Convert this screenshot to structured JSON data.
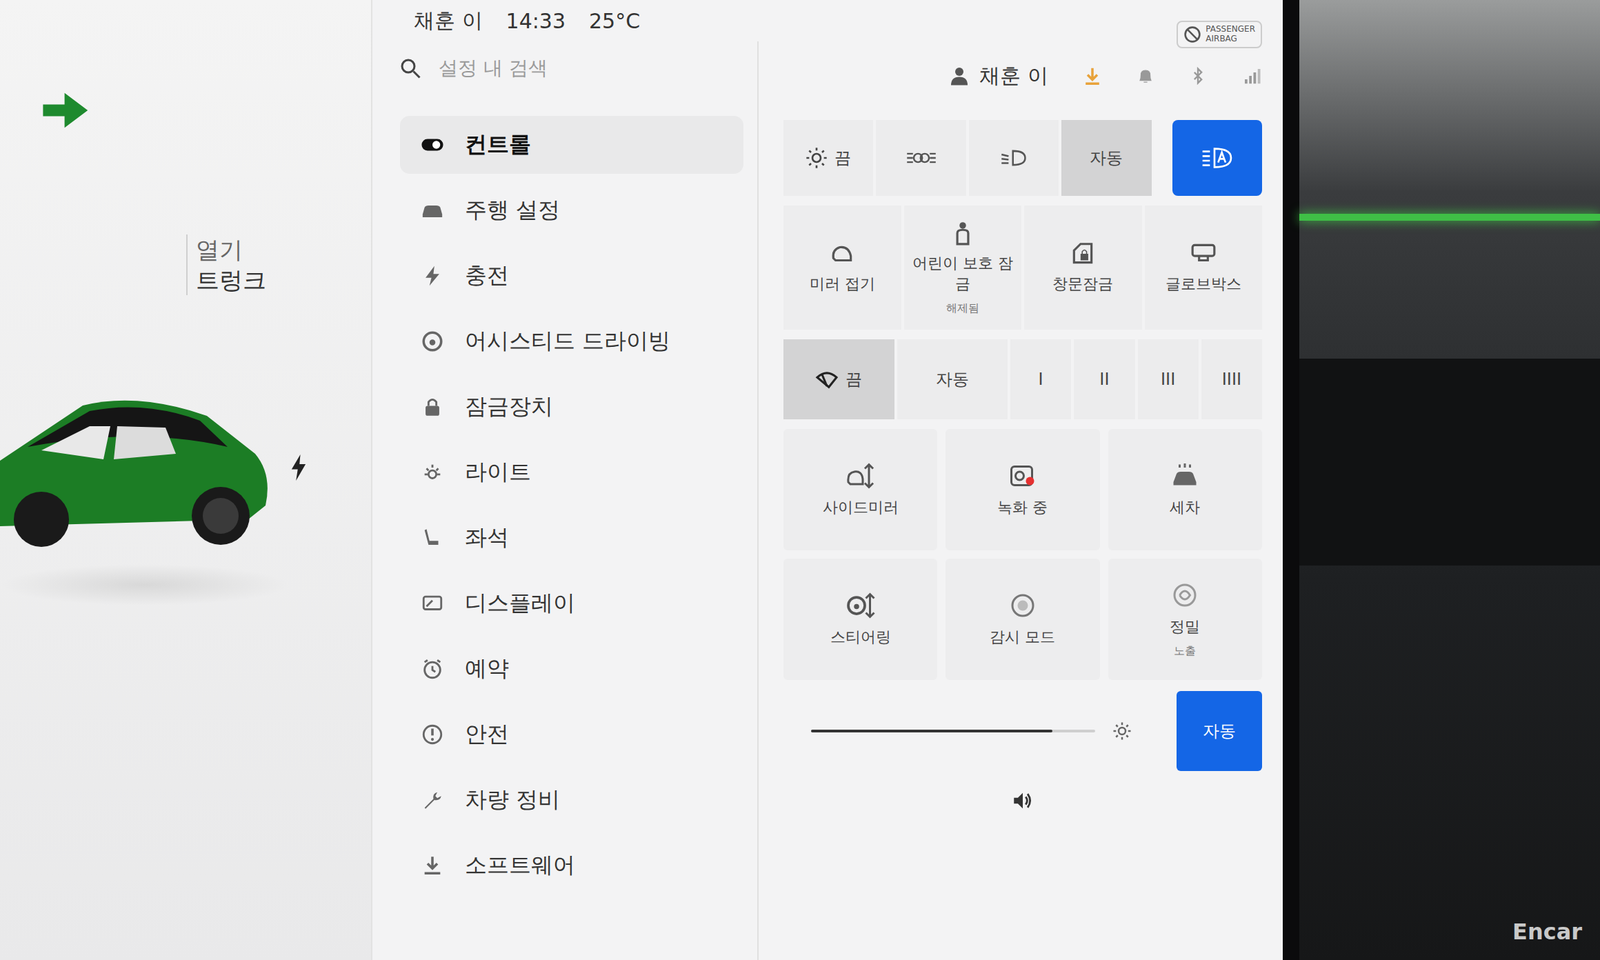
{
  "status_bar": {
    "profile": "채훈 이",
    "time": "14:33",
    "temperature": "25°C"
  },
  "airbag_badge": {
    "line1": "PASSENGER",
    "line2": "AIRBAG"
  },
  "car_panel": {
    "open_label": "열기",
    "trunk_label": "트렁크",
    "charging": true
  },
  "search": {
    "placeholder": "설정 내 검색"
  },
  "menu": [
    {
      "label": "컨트롤",
      "kind": "controls",
      "selected": true
    },
    {
      "label": "주행 설정",
      "kind": "car",
      "selected": false
    },
    {
      "label": "충전",
      "kind": "charge",
      "selected": false
    },
    {
      "label": "어시스티드 드라이빙",
      "kind": "wheel",
      "selected": false
    },
    {
      "label": "잠금장치",
      "kind": "lock",
      "selected": false
    },
    {
      "label": "라이트",
      "kind": "light",
      "selected": false
    },
    {
      "label": "좌석",
      "kind": "seat",
      "selected": false
    },
    {
      "label": "디스플레이",
      "kind": "display",
      "selected": false
    },
    {
      "label": "예약",
      "kind": "clock",
      "selected": false
    },
    {
      "label": "안전",
      "kind": "alert",
      "selected": false
    },
    {
      "label": "차량 정비",
      "kind": "wrench",
      "selected": false
    },
    {
      "label": "소프트웨어",
      "kind": "download",
      "selected": false
    }
  ],
  "profile": {
    "name": "채훈 이"
  },
  "lights": [
    {
      "kind": "off",
      "label": "끔",
      "selected": false
    },
    {
      "kind": "parking",
      "label": "",
      "selected": false
    },
    {
      "kind": "lowbeam",
      "label": "",
      "selected": false
    },
    {
      "kind": "auto",
      "label": "자동",
      "selected": true
    },
    {
      "kind": "autohigh",
      "label": "",
      "selected": true
    }
  ],
  "tiles_top": [
    {
      "kind": "mirror-fold",
      "label": "미러 접기",
      "sub": ""
    },
    {
      "kind": "child-lock",
      "label": "어린이 보호 잠금",
      "sub": "해제됨"
    },
    {
      "kind": "window-lock",
      "label": "창문잠금",
      "sub": ""
    },
    {
      "kind": "glovebox",
      "label": "글로브박스",
      "sub": ""
    }
  ],
  "wipers": [
    {
      "label": "끔",
      "selected": true
    },
    {
      "label": "자동",
      "selected": false
    },
    {
      "label": "I",
      "selected": false
    },
    {
      "label": "II",
      "selected": false
    },
    {
      "label": "III",
      "selected": false
    },
    {
      "label": "IIII",
      "selected": false
    }
  ],
  "tiles_bottom": [
    {
      "kind": "side-mirror",
      "label": "사이드미러",
      "sub": "",
      "recording": false
    },
    {
      "kind": "dashcam",
      "label": "녹화 중",
      "sub": "",
      "recording": true
    },
    {
      "kind": "carwash",
      "label": "세차",
      "sub": "",
      "recording": false
    },
    {
      "kind": "steering",
      "label": "스티어링",
      "sub": "",
      "recording": false
    },
    {
      "kind": "sentry",
      "label": "감시 모드",
      "sub": "",
      "recording": false
    },
    {
      "kind": "precision",
      "label": "정밀",
      "sub": "노출",
      "recording": false
    }
  ],
  "brightness": {
    "level": 0.85,
    "auto_label": "자동",
    "auto_on": true
  },
  "watermark": "Encar"
}
